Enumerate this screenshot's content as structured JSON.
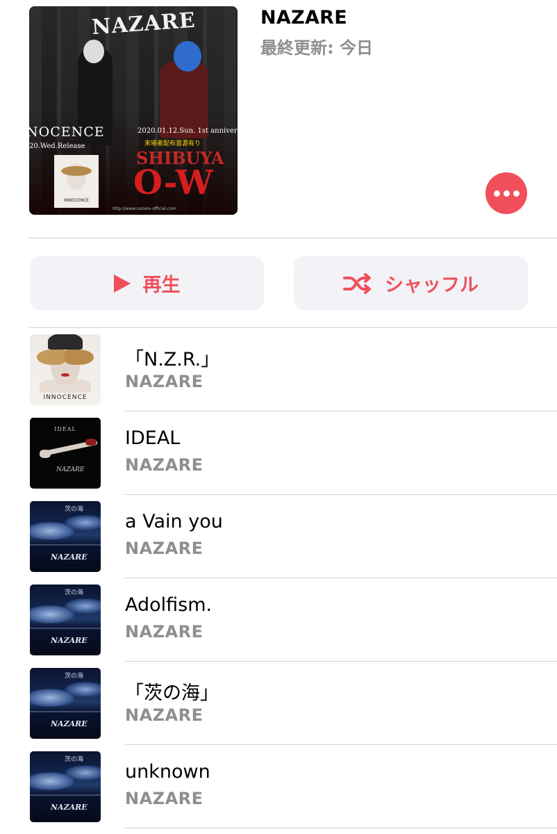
{
  "header": {
    "title": "NAZARE",
    "subtitle": "最終更新: 今日",
    "cover": {
      "logo": "NAZARE",
      "innocence": "NOCENCE",
      "release": "20.Wed.Release",
      "date_line": "2020.01.12.Sun. 1st anniver",
      "sub_line": "来場者配布音源有り",
      "venue": "SHIBUYA",
      "venue_big": "O-W",
      "mini_label": "INNOCENCE",
      "url": "http://www.nazare-official.com"
    },
    "more_icon": "ellipsis-icon"
  },
  "actions": {
    "play_label": "再生",
    "shuffle_label": "シャッフル",
    "accent_color": "#f04f5b"
  },
  "tracks": [
    {
      "title": "「N.Z.R.」",
      "artist": "NAZARE",
      "art": "innocence",
      "art_label": "INNOCENCE"
    },
    {
      "title": "IDEAL",
      "artist": "NAZARE",
      "art": "ideal",
      "art_label": "IDEAL",
      "art_logo": "NAZARE"
    },
    {
      "title": "a Vain you",
      "artist": "NAZARE",
      "art": "sea",
      "art_label": "茨の海",
      "art_logo": "NAZARE"
    },
    {
      "title": "Adolfism.",
      "artist": "NAZARE",
      "art": "sea",
      "art_label": "茨の海",
      "art_logo": "NAZARE"
    },
    {
      "title": "「茨の海」",
      "artist": "NAZARE",
      "art": "sea",
      "art_label": "茨の海",
      "art_logo": "NAZARE"
    },
    {
      "title": "unknown",
      "artist": "NAZARE",
      "art": "sea",
      "art_label": "茨の海",
      "art_logo": "NAZARE"
    }
  ]
}
